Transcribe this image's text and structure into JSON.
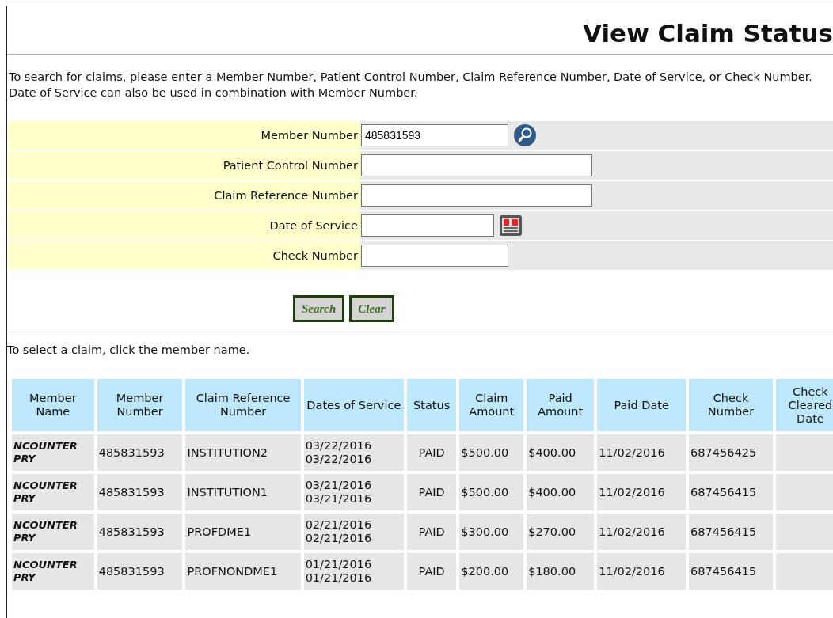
{
  "title": "View Claim Status",
  "instructions": "To search for claims, please enter a Member Number, Patient Control Number, Claim Reference Number, Date of Service, or Check Number. Date of Service can also be used in combination with Member Number.",
  "form": {
    "fields": [
      {
        "label": "Member Number",
        "value": "485831593",
        "kind": "lookup"
      },
      {
        "label": "Patient Control Number",
        "kind": "text"
      },
      {
        "label": "Claim Reference Number",
        "kind": "text"
      },
      {
        "label": "Date of Service",
        "kind": "date"
      },
      {
        "label": "Check Number",
        "kind": "short"
      }
    ]
  },
  "buttons": [
    "Search",
    "Clear"
  ],
  "select_hint": "To select a claim, click the member name.",
  "table": {
    "columns": [
      "Member Name",
      "Member Number",
      "Claim Reference Number",
      "Dates of Service",
      "Status",
      "Claim Amount",
      "Paid Amount",
      "Paid Date",
      "Check Number",
      "Check Cleared Date"
    ],
    "rows": [
      {
        "member_name": "NCOUNTER PRY",
        "member_number": "485831593",
        "claim_reference": "INSTITUTION2",
        "dates": [
          "03/22/2016",
          "03/22/2016"
        ],
        "status": "PAID",
        "claim_amount": "$500.00",
        "paid_amount": "$400.00",
        "paid_date": "11/02/2016",
        "check_number": "687456425"
      },
      {
        "member_name": "NCOUNTER PRY",
        "member_number": "485831593",
        "claim_reference": "INSTITUTION1",
        "dates": [
          "03/21/2016",
          "03/21/2016"
        ],
        "status": "PAID",
        "claim_amount": "$500.00",
        "paid_amount": "$400.00",
        "paid_date": "11/02/2016",
        "check_number": "687456415"
      },
      {
        "member_name": "NCOUNTER PRY",
        "member_number": "485831593",
        "claim_reference": "PROFDME1",
        "dates": [
          "02/21/2016",
          "02/21/2016"
        ],
        "status": "PAID",
        "claim_amount": "$300.00",
        "paid_amount": "$270.00",
        "paid_date": "11/02/2016",
        "check_number": "687456415"
      },
      {
        "member_name": "NCOUNTER PRY",
        "member_number": "485831593",
        "claim_reference": "PROFNONDME1",
        "dates": [
          "01/21/2016",
          "01/21/2016"
        ],
        "status": "PAID",
        "claim_amount": "$200.00",
        "paid_amount": "$180.00",
        "paid_date": "11/02/2016",
        "check_number": "687456415"
      }
    ]
  }
}
